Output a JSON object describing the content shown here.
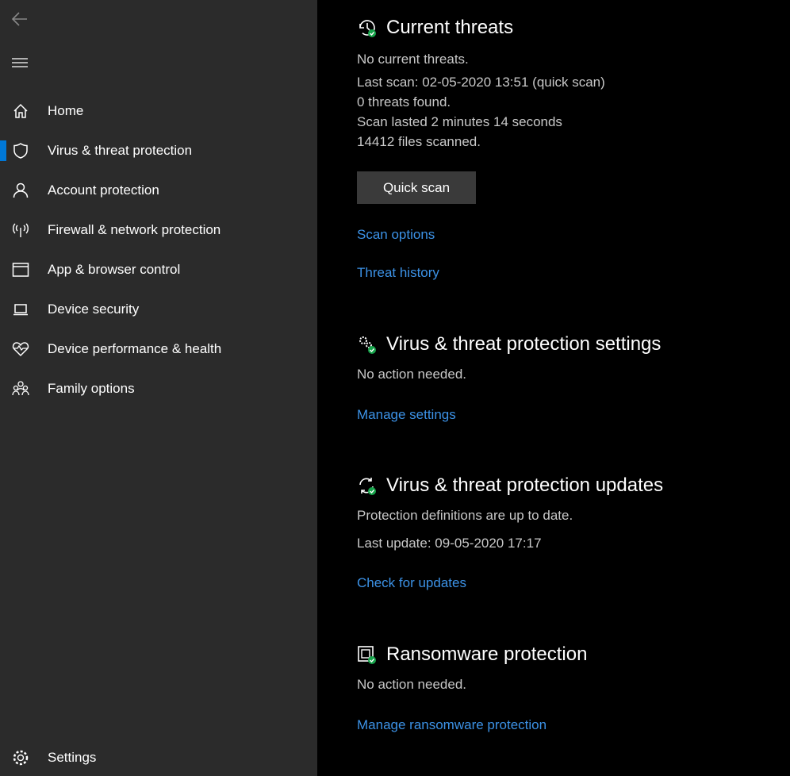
{
  "sidebar": {
    "items": [
      {
        "label": "Home",
        "icon": "home-icon"
      },
      {
        "label": "Virus & threat protection",
        "icon": "shield-icon",
        "selected": true
      },
      {
        "label": "Account protection",
        "icon": "person-icon"
      },
      {
        "label": "Firewall & network protection",
        "icon": "antenna-icon"
      },
      {
        "label": "App & browser control",
        "icon": "browser-window-icon"
      },
      {
        "label": "Device security",
        "icon": "laptop-icon"
      },
      {
        "label": "Device performance & health",
        "icon": "heart-icon"
      },
      {
        "label": "Family options",
        "icon": "family-icon"
      }
    ],
    "settings": {
      "label": "Settings",
      "icon": "gear-icon"
    }
  },
  "current_threats": {
    "title": "Current threats",
    "status": "No current threats.",
    "last_scan": "Last scan: 02-05-2020 13:51 (quick scan)",
    "threats_found": "0 threats found.",
    "duration": "Scan lasted 2 minutes 14 seconds",
    "files": "14412 files scanned.",
    "quick_scan": "Quick scan",
    "scan_options": "Scan options",
    "threat_history": "Threat history"
  },
  "settings_section": {
    "title": "Virus & threat protection settings",
    "status": "No action needed.",
    "link": "Manage settings"
  },
  "updates_section": {
    "title": "Virus & threat protection updates",
    "status": "Protection definitions are up to date.",
    "last_update": "Last update: 09-05-2020 17:17",
    "link": "Check for updates"
  },
  "ransomware_section": {
    "title": "Ransomware protection",
    "status": "No action needed.",
    "link": "Manage ransomware protection"
  },
  "colors": {
    "accent": "#0078d7",
    "link": "#3c92e6",
    "ok": "#16a34a",
    "sidebar": "#2b2b2b"
  }
}
